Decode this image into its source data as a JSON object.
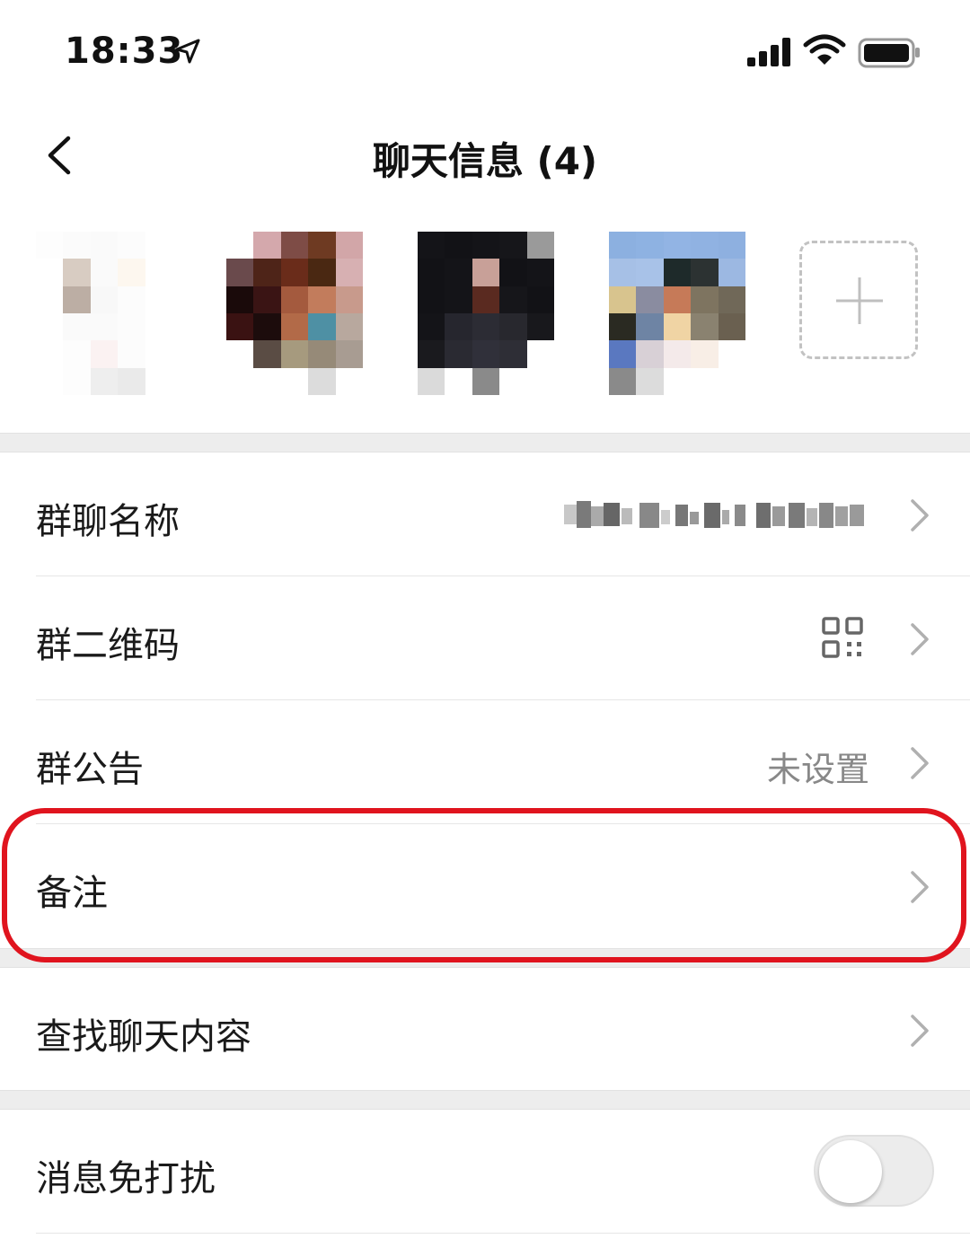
{
  "status_bar": {
    "time": "18:33"
  },
  "nav": {
    "title": "聊天信息 (4)"
  },
  "settings": {
    "group_name": {
      "label": "群聊名称"
    },
    "group_qr": {
      "label": "群二维码"
    },
    "announcement": {
      "label": "群公告",
      "value": "未设置"
    },
    "remark": {
      "label": "备注"
    },
    "search_history": {
      "label": "查找聊天内容"
    },
    "mute": {
      "label": "消息免打扰",
      "on": false
    }
  },
  "colors": {
    "highlight": "#e0141e",
    "section_gap": "#ededed",
    "secondary_text": "#888888"
  }
}
